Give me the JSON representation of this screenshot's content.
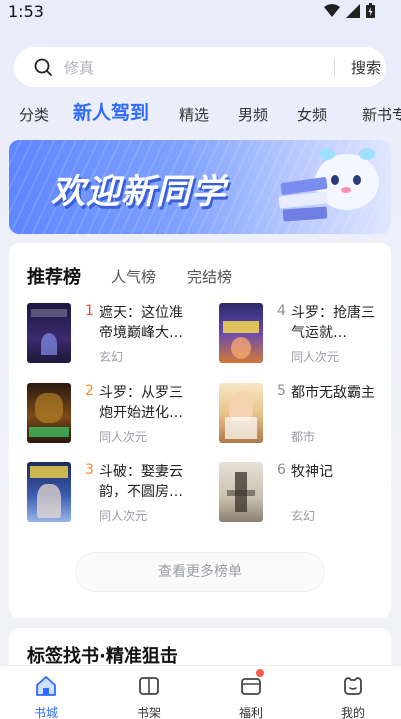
{
  "status": {
    "time": "1:53"
  },
  "search": {
    "placeholder": "修真",
    "button": "搜索"
  },
  "tabs": [
    "分类",
    "新人驾到",
    "精选",
    "男频",
    "女频",
    "新书专"
  ],
  "banner": {
    "text": "欢迎新同学"
  },
  "ranking": {
    "tabs": [
      "推荐榜",
      "人气榜",
      "完结榜"
    ],
    "books": [
      {
        "rank": "1",
        "title": "遮天：这位准帝境巅峰大…",
        "genre": "玄幻"
      },
      {
        "rank": "2",
        "title": "斗罗：从罗三炮开始进化…",
        "genre": "同人次元"
      },
      {
        "rank": "3",
        "title": "斗破：娶妻云韵，不圆房…",
        "genre": "同人次元"
      },
      {
        "rank": "4",
        "title": "斗罗：抢唐三气运就…",
        "genre": "同人次元"
      },
      {
        "rank": "5",
        "title": "都市无敌霸主",
        "genre": "都市"
      },
      {
        "rank": "6",
        "title": "牧神记",
        "genre": "玄幻"
      }
    ],
    "more": "查看更多榜单"
  },
  "tag_section": {
    "title": "标签找书·精准狙击"
  },
  "bottom_nav": [
    "书城",
    "书架",
    "福利",
    "我的"
  ],
  "colors": {
    "accent": "#2f6bff",
    "rank_top3": "#ff8a2b",
    "rank_first": "#f2453d",
    "rank_other": "#8c8f96"
  }
}
